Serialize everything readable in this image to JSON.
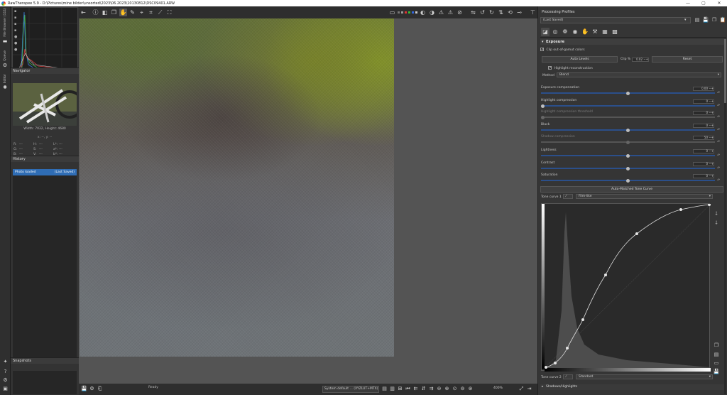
{
  "window": {
    "title": "RawTherapee 5.9 - D:\\Pictures\\mine bilder\\unsorted\\2023\\06.2023\\10130812\\DSC09401.ARW",
    "controls": [
      "—",
      "▢",
      "✕"
    ]
  },
  "left_tabs": {
    "file_browser": "File Browser (111)",
    "queue": "Queue",
    "editor": "Editor"
  },
  "navigator": {
    "header": "Navigator",
    "size_text": "Width: 7032, Height: 4680",
    "coords": "x: --, y: --",
    "channels": [
      {
        "l1": "R:",
        "v1": "---",
        "l2": "H:",
        "v2": "---",
        "l3": "L*:",
        "v3": "---"
      },
      {
        "l1": "G:",
        "v1": "---",
        "l2": "S:",
        "v2": "---",
        "l3": "a*:",
        "v3": "---"
      },
      {
        "l1": "B:",
        "v1": "---",
        "l2": "V:",
        "v2": "---",
        "l3": "b*:",
        "v3": "---"
      }
    ]
  },
  "history": {
    "header": "History",
    "items": [
      {
        "label": "Photo loaded",
        "state": "(Last Saved)"
      }
    ]
  },
  "snapshots": {
    "header": "Snapshots",
    "add": "+",
    "remove": "−"
  },
  "status": {
    "ready": "Ready",
    "profile": "System default ... (XYZLUT+MTX)",
    "zoom": "400%"
  },
  "right_panel": {
    "title": "Processing Profiles",
    "profile_value": "(Last Saved)",
    "exposure": {
      "header": "Exposure",
      "clip_label": "Clip out-of-gamut colors",
      "auto_levels": "Auto Levels",
      "clip_pct_label": "Clip %",
      "clip_pct_value": "0.02",
      "reset": "Reset",
      "highlight_recon": "Highlight reconstruction",
      "method_label": "Method",
      "method_value": "Blend",
      "sliders": [
        {
          "label": "Exposure compensation",
          "value": "0.00",
          "level": 0.5,
          "enabled": true
        },
        {
          "label": "Highlight compression",
          "value": "0",
          "level": 0.0,
          "enabled": true
        },
        {
          "label": "Highlight compression threshold",
          "value": "0",
          "level": 0.0,
          "enabled": false
        },
        {
          "label": "Black",
          "value": "0",
          "level": 0.5,
          "enabled": true
        },
        {
          "label": "Shadow compression",
          "value": "50",
          "level": 0.5,
          "enabled": false
        },
        {
          "label": "Lightness",
          "value": "0",
          "level": 0.5,
          "enabled": true
        },
        {
          "label": "Contrast",
          "value": "0",
          "level": 0.5,
          "enabled": true
        },
        {
          "label": "Saturation",
          "value": "0",
          "level": 0.5,
          "enabled": true
        }
      ],
      "auto_tone": "Auto-Matched Tone Curve",
      "tone_curve_1_label": "Tone curve 1",
      "tone_curve_1_type": "Film-like",
      "tone_curve_2_label": "Tone curve 2",
      "tone_curve_2_type": "Standard"
    },
    "shadows_highlights": "Shadows/Highlights"
  },
  "colors": {
    "accent": "#2f6db5",
    "slider_track": "#2b4f8a"
  }
}
